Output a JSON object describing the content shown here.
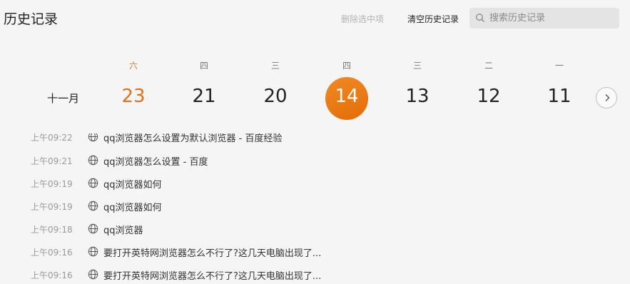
{
  "header": {
    "title": "历史记录",
    "delete_selected": "删除选中项",
    "clear_history": "清空历史记录",
    "search_placeholder": "搜索历史记录"
  },
  "calendar": {
    "month": "十一月",
    "days": [
      {
        "weekday": "六",
        "date": "23"
      },
      {
        "weekday": "四",
        "date": "21"
      },
      {
        "weekday": "三",
        "date": "20"
      },
      {
        "weekday": "四",
        "date": "14"
      },
      {
        "weekday": "三",
        "date": "13"
      },
      {
        "weekday": "二",
        "date": "12"
      },
      {
        "weekday": "一",
        "date": "11"
      }
    ],
    "selected_date": "14"
  },
  "history": [
    {
      "time": "上午09:22",
      "title": "qq浏览器怎么设置为默认浏览器 - 百度经验"
    },
    {
      "time": "上午09:21",
      "title": "qq浏览器怎么设置 - 百度"
    },
    {
      "time": "上午09:19",
      "title": "qq浏览器如何"
    },
    {
      "time": "上午09:19",
      "title": "qq浏览器如何"
    },
    {
      "time": "上午09:18",
      "title": "qq浏览器"
    },
    {
      "time": "上午09:16",
      "title": "要打开英特网浏览器怎么不行了?这几天电脑出现了..."
    },
    {
      "time": "上午09:16",
      "title": "要打开英特网浏览器怎么不行了?这几天电脑出现了..."
    }
  ],
  "colors": {
    "accent": "#e46c07",
    "saturday": "#e2711d",
    "background": "#f5f5f5"
  }
}
